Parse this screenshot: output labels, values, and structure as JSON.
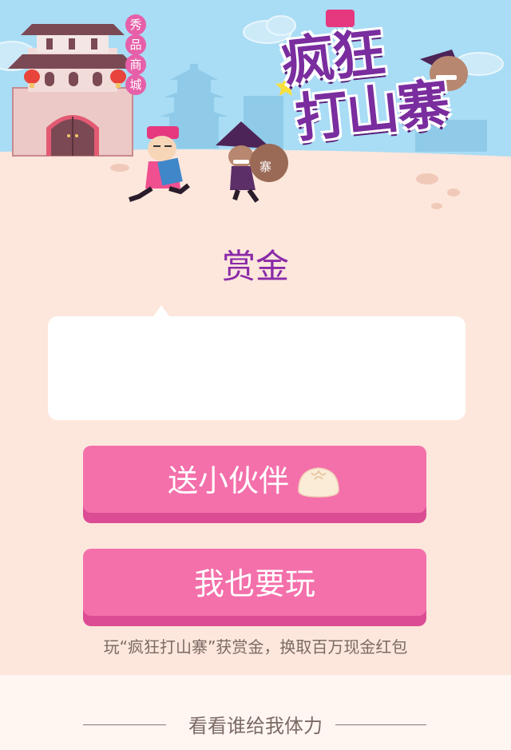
{
  "hero": {
    "mall_badge": [
      "秀",
      "品",
      "商",
      "城"
    ],
    "game_title_line1": "疯狂",
    "game_title_line2": "打山寨",
    "sack_label": "寨"
  },
  "reward": {
    "title": "赏金",
    "amount": ""
  },
  "buttons": {
    "share_label": "送小伙伴",
    "play_label": "我也要玩"
  },
  "hint": "玩“疯狂打山寨”获赏金，换取百万现金红包",
  "friends": {
    "title": "看看谁给我体力"
  },
  "colors": {
    "accent_purple": "#8a2aa8",
    "button_pink": "#f470ab",
    "page_bg": "#fde7dc"
  }
}
